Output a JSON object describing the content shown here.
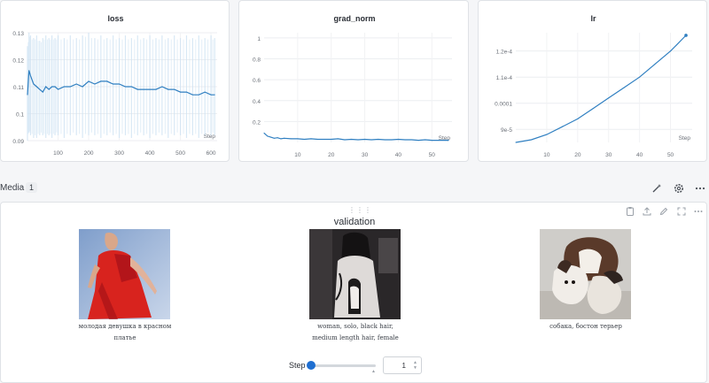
{
  "charts": {
    "loss": {
      "title": "loss",
      "y_ticks": [
        "0.13",
        "0.12",
        "0.11",
        "0.1",
        "0.09"
      ],
      "x_ticks": [
        "100",
        "200",
        "300",
        "400",
        "500",
        "600"
      ],
      "step_label": "Step"
    },
    "grad_norm": {
      "title": "grad_norm",
      "y_ticks": [
        "1",
        "0.8",
        "0.6",
        "0.4",
        "0.2"
      ],
      "x_ticks": [
        "10",
        "20",
        "30",
        "40",
        "50"
      ],
      "step_label": "Step"
    },
    "lr": {
      "title": "lr",
      "y_ticks": [
        "1.2e-4",
        "1.1e-4",
        "0.0001",
        "9e-5"
      ],
      "x_ticks": [
        "10",
        "20",
        "30",
        "40",
        "50"
      ],
      "step_label": "Step"
    }
  },
  "chart_data": [
    {
      "type": "line",
      "title": "loss",
      "xlabel": "Step",
      "xlim": [
        0,
        620
      ],
      "ylim": [
        0.09,
        0.13
      ],
      "series": [
        {
          "x": [
            0,
            5,
            10,
            20,
            30,
            40,
            50,
            60,
            70,
            80,
            90,
            100,
            120,
            140,
            160,
            180,
            200,
            220,
            240,
            260,
            280,
            300,
            320,
            340,
            360,
            380,
            400,
            420,
            440,
            460,
            480,
            500,
            520,
            540,
            560,
            580,
            600,
            612
          ],
          "y": [
            0.107,
            0.116,
            0.114,
            0.111,
            0.11,
            0.109,
            0.108,
            0.11,
            0.109,
            0.11,
            0.11,
            0.109,
            0.11,
            0.11,
            0.111,
            0.11,
            0.112,
            0.111,
            0.112,
            0.112,
            0.111,
            0.111,
            0.11,
            0.11,
            0.109,
            0.109,
            0.109,
            0.109,
            0.11,
            0.109,
            0.109,
            0.108,
            0.108,
            0.107,
            0.107,
            0.108,
            0.107,
            0.107
          ],
          "min_band": [
            0.09,
            0.093,
            0.092,
            0.091,
            0.091,
            0.092,
            0.092,
            0.091,
            0.092,
            0.091,
            0.092,
            0.092,
            0.091,
            0.092,
            0.092,
            0.091,
            0.092,
            0.092,
            0.091,
            0.092,
            0.092,
            0.091,
            0.092,
            0.091,
            0.092,
            0.092,
            0.091,
            0.092,
            0.092,
            0.091,
            0.092,
            0.092,
            0.091,
            0.092,
            0.091,
            0.092,
            0.092,
            0.092
          ],
          "max_band": [
            0.125,
            0.13,
            0.129,
            0.128,
            0.129,
            0.127,
            0.128,
            0.129,
            0.128,
            0.129,
            0.128,
            0.129,
            0.128,
            0.129,
            0.128,
            0.129,
            0.13,
            0.128,
            0.129,
            0.128,
            0.129,
            0.128,
            0.129,
            0.128,
            0.129,
            0.128,
            0.129,
            0.128,
            0.129,
            0.128,
            0.129,
            0.128,
            0.129,
            0.128,
            0.129,
            0.128,
            0.129,
            0.128
          ]
        }
      ]
    },
    {
      "type": "line",
      "title": "grad_norm",
      "xlabel": "Step",
      "xlim": [
        0,
        56
      ],
      "ylim": [
        0,
        1.05
      ],
      "series": [
        {
          "x": [
            0,
            1,
            2,
            3,
            4,
            5,
            6,
            8,
            10,
            12,
            14,
            16,
            18,
            20,
            22,
            24,
            26,
            28,
            30,
            32,
            34,
            36,
            38,
            40,
            42,
            44,
            46,
            48,
            50,
            52,
            54,
            55
          ],
          "y": [
            0.09,
            0.06,
            0.05,
            0.04,
            0.045,
            0.035,
            0.04,
            0.035,
            0.035,
            0.03,
            0.035,
            0.03,
            0.03,
            0.03,
            0.035,
            0.025,
            0.03,
            0.025,
            0.03,
            0.025,
            0.03,
            0.025,
            0.025,
            0.03,
            0.025,
            0.025,
            0.02,
            0.025,
            0.02,
            0.02,
            0.02,
            0.02
          ]
        }
      ]
    },
    {
      "type": "line",
      "title": "lr",
      "xlabel": "Step",
      "xlim": [
        0,
        57
      ],
      "ylim": [
        8.5e-05,
        0.000127
      ],
      "series": [
        {
          "x": [
            0,
            5,
            10,
            15,
            20,
            25,
            30,
            35,
            40,
            45,
            50,
            55
          ],
          "y": [
            8.5e-05,
            8.6e-05,
            8.8e-05,
            9.1e-05,
            9.4e-05,
            9.8e-05,
            0.000102,
            0.000106,
            0.00011,
            0.000115,
            0.00012,
            0.000126
          ]
        }
      ]
    }
  ],
  "media": {
    "title": "Media",
    "count": "1",
    "panel": {
      "title": "validation",
      "captions": [
        [
          "молодая девушка в красном",
          "платье"
        ],
        [
          "woman, solo, black hair,",
          "medium length hair, female"
        ],
        [
          "собака, бостон терьер"
        ]
      ]
    },
    "step": {
      "label": "Step",
      "value": "1",
      "slider_fraction": 0.0
    }
  },
  "colors": {
    "line": "#2f7fc1",
    "band": "#cfe3f3",
    "accent": "#1f6fd1"
  }
}
